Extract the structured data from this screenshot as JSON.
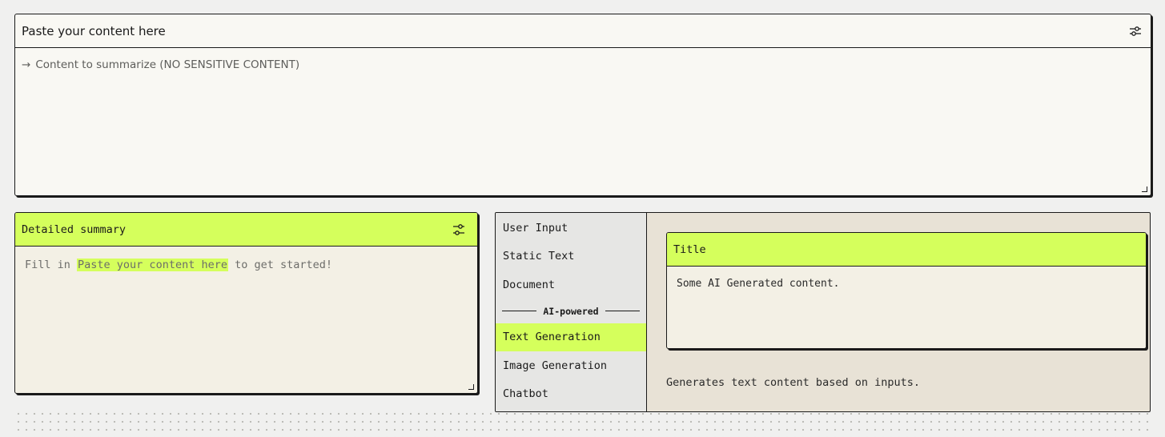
{
  "input_panel": {
    "title": "Paste your content here",
    "arrow": "→",
    "placeholder": "Content to summarize (NO SENSITIVE CONTENT)",
    "settings_icon": "sliders-icon"
  },
  "summary_panel": {
    "title": "Detailed summary",
    "body_prefix": "Fill in ",
    "body_highlight": "Paste your content here",
    "body_suffix": " to get started!",
    "settings_icon": "sliders-icon"
  },
  "gallery": {
    "menu": {
      "items_top": [
        "User Input",
        "Static Text",
        "Document"
      ],
      "divider_label": "AI-powered",
      "items_ai": [
        "Text Generation",
        "Image Generation",
        "Chatbot"
      ],
      "active": "Text Generation"
    },
    "preview": {
      "card_title": "Title",
      "card_body": "Some AI Generated content.",
      "description": "Generates text content based on inputs."
    }
  },
  "colors": {
    "accent": "#d5ff5c",
    "border": "#1a1a1a",
    "panel_bg": "#f3f0e5",
    "page_bg": "#f0f0ef"
  }
}
